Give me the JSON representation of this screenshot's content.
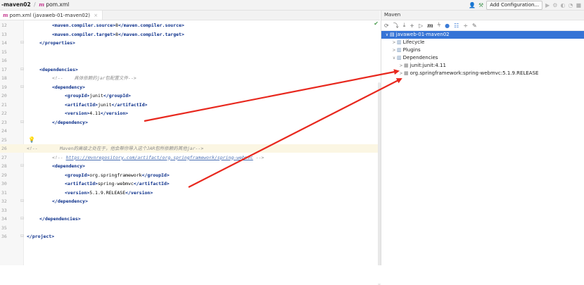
{
  "navbar": {
    "project": "-maven02",
    "separator": "/",
    "file_icon": "m",
    "file": "pom.xml",
    "config_button": "Add Configuration..."
  },
  "editor_tab": {
    "icon": "m",
    "label": "pom.xml (javaweb-01-maven02)",
    "close": "×"
  },
  "editor": {
    "lines": [
      {
        "num": "12",
        "indent": 74,
        "parts": [
          {
            "t": "tag",
            "v": "<maven.compiler.source>"
          },
          {
            "t": "txt",
            "v": "8"
          },
          {
            "t": "tag",
            "v": "</maven.compiler.source>"
          }
        ]
      },
      {
        "num": "13",
        "indent": 74,
        "parts": [
          {
            "t": "tag",
            "v": "<maven.compiler.target>"
          },
          {
            "t": "txt",
            "v": "8"
          },
          {
            "t": "tag",
            "v": "</maven.compiler.target>"
          }
        ]
      },
      {
        "num": "14",
        "indent": 56,
        "parts": [
          {
            "t": "tag",
            "v": "</properties>"
          }
        ]
      },
      {
        "num": "15",
        "indent": 56,
        "parts": []
      },
      {
        "num": "16",
        "indent": 56,
        "parts": []
      },
      {
        "num": "17",
        "indent": 56,
        "parts": [
          {
            "t": "tag",
            "v": "<dependencies>"
          }
        ]
      },
      {
        "num": "18",
        "indent": 74,
        "parts": [
          {
            "t": "cmt",
            "v": "<!--    具体依赖的jar包配置文件-->"
          }
        ]
      },
      {
        "num": "19",
        "indent": 74,
        "parts": [
          {
            "t": "tag",
            "v": "<dependency>"
          }
        ]
      },
      {
        "num": "20",
        "indent": 92,
        "parts": [
          {
            "t": "tag",
            "v": "<groupId>"
          },
          {
            "t": "txt",
            "v": "junit"
          },
          {
            "t": "tag",
            "v": "</groupId>"
          }
        ]
      },
      {
        "num": "21",
        "indent": 92,
        "parts": [
          {
            "t": "tag",
            "v": "<artifactId>"
          },
          {
            "t": "txt",
            "v": "junit"
          },
          {
            "t": "tag",
            "v": "</artifactId>"
          }
        ]
      },
      {
        "num": "22",
        "indent": 92,
        "parts": [
          {
            "t": "tag",
            "v": "<version>"
          },
          {
            "t": "txt",
            "v": "4.11"
          },
          {
            "t": "tag",
            "v": "</version>"
          }
        ]
      },
      {
        "num": "23",
        "indent": 74,
        "parts": [
          {
            "t": "tag",
            "v": "</dependency>"
          }
        ]
      },
      {
        "num": "24",
        "indent": 56,
        "parts": []
      },
      {
        "num": "25",
        "indent": 56,
        "parts": []
      },
      {
        "num": "26",
        "indent": 38,
        "parts": [
          {
            "t": "cmt",
            "v": "<!--        Maven的高级之处在于，他会帮你导入这个JAR包所依赖的其他jar-->"
          }
        ]
      },
      {
        "num": "27",
        "indent": 74,
        "parts": [
          {
            "t": "cmt",
            "v": "<!-- "
          },
          {
            "t": "link",
            "v": "https://mvnrepository.com/artifact/org.springframework/spring-webmvc"
          },
          {
            "t": "cmt",
            "v": " -->"
          }
        ]
      },
      {
        "num": "28",
        "indent": 74,
        "parts": [
          {
            "t": "tag",
            "v": "<dependency>"
          }
        ]
      },
      {
        "num": "29",
        "indent": 92,
        "parts": [
          {
            "t": "tag",
            "v": "<groupId>"
          },
          {
            "t": "txt",
            "v": "org.springframework"
          },
          {
            "t": "tag",
            "v": "</groupId>"
          }
        ]
      },
      {
        "num": "30",
        "indent": 92,
        "parts": [
          {
            "t": "tag",
            "v": "<artifactId>"
          },
          {
            "t": "txt",
            "v": "spring-webmvc"
          },
          {
            "t": "tag",
            "v": "</artifactId>"
          }
        ]
      },
      {
        "num": "31",
        "indent": 92,
        "parts": [
          {
            "t": "tag",
            "v": "<version>"
          },
          {
            "t": "txt",
            "v": "5.1.9.RELEASE"
          },
          {
            "t": "tag",
            "v": "</version>"
          }
        ]
      },
      {
        "num": "32",
        "indent": 74,
        "parts": [
          {
            "t": "tag",
            "v": "</dependency>"
          }
        ]
      },
      {
        "num": "33",
        "indent": 56,
        "parts": []
      },
      {
        "num": "34",
        "indent": 56,
        "parts": [
          {
            "t": "tag",
            "v": "</dependencies>"
          }
        ]
      },
      {
        "num": "35",
        "indent": 38,
        "parts": []
      },
      {
        "num": "36",
        "indent": 38,
        "parts": [
          {
            "t": "tag",
            "v": "</project>"
          }
        ]
      }
    ]
  },
  "maven": {
    "title": "Maven",
    "tree": [
      {
        "label": "javaweb-01-maven02",
        "level": 0,
        "chev": "∨",
        "icon": "proj",
        "selected": true
      },
      {
        "label": "Lifecycle",
        "level": 1,
        "chev": ">",
        "icon": "folder",
        "selected": false
      },
      {
        "label": "Plugins",
        "level": 1,
        "chev": ">",
        "icon": "folder",
        "selected": false
      },
      {
        "label": "Dependencies",
        "level": 1,
        "chev": "∨",
        "icon": "folder",
        "selected": false
      },
      {
        "label": "junit:junit:4.11",
        "level": 2,
        "chev": ">",
        "icon": "lib",
        "selected": false
      },
      {
        "label": "org.springframework:spring-webmvc:5.1.9.RELEASE",
        "level": 2,
        "chev": ">",
        "icon": "lib",
        "selected": false
      }
    ]
  },
  "colors": {
    "arrow": "#e8281e",
    "selection": "#3574d6",
    "xml_tag": "#0b2f8a"
  }
}
